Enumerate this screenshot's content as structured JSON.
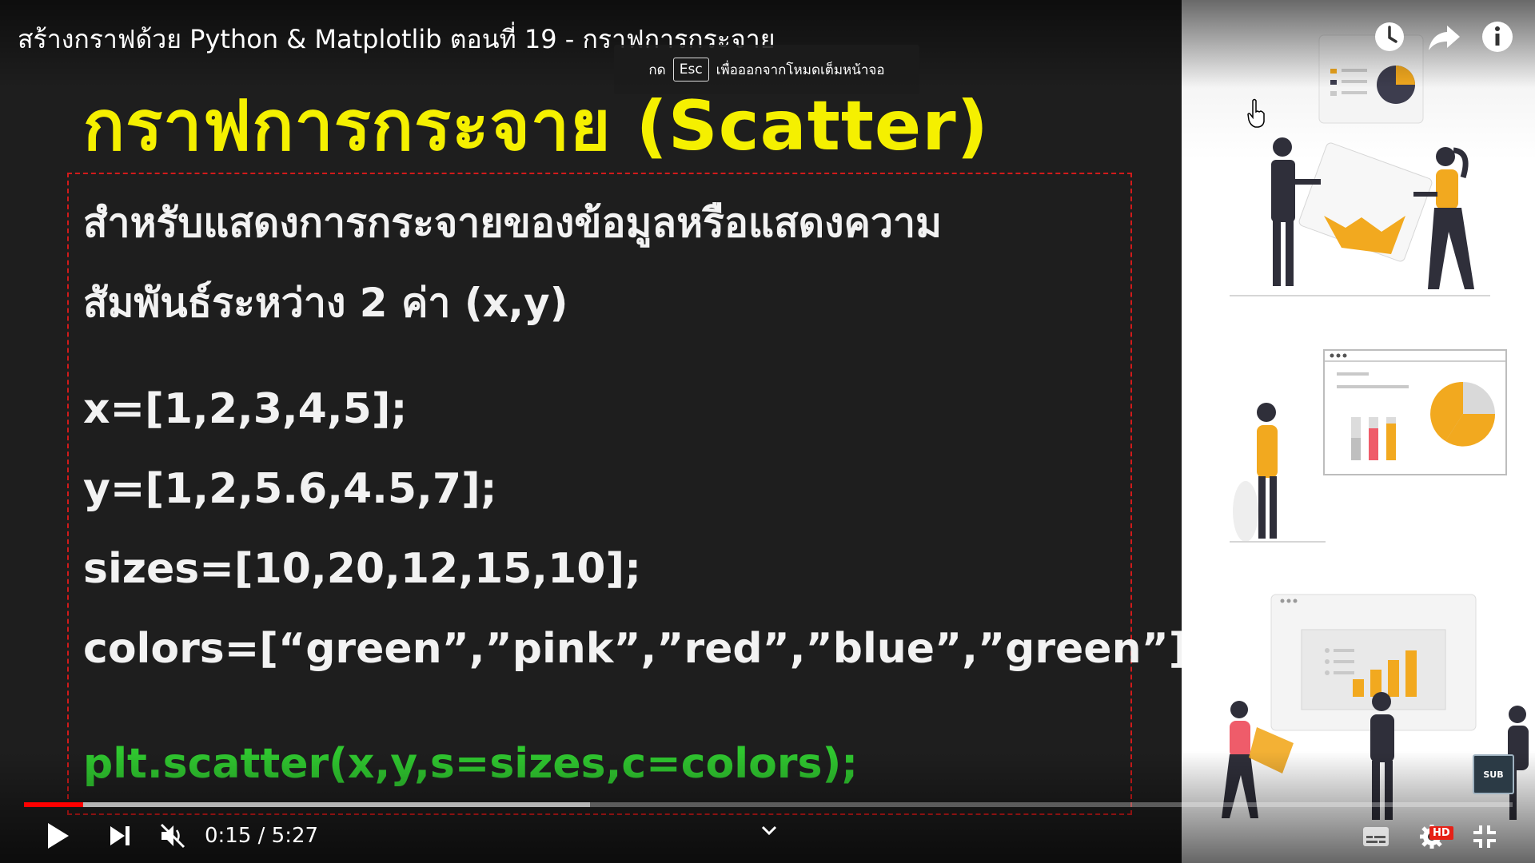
{
  "player": {
    "video_title": "สร้างกราฟด้วย Python & Matplotlib ตอนที่ 19 - กราฟการกระจาย",
    "esc_hint": {
      "prefix": "กด",
      "key": "Esc",
      "suffix": "เพื่อออกจากโหมดเต็มหน้าจอ"
    },
    "time_display": "0:15 / 5:27",
    "progress": {
      "played_fraction": 0.04,
      "buffered_fraction": 0.38
    },
    "hd_badge": "HD",
    "watermark_label": "SUB",
    "icons": {
      "top": [
        "clock-icon",
        "share-icon",
        "info-icon"
      ],
      "controls": [
        "play-icon",
        "next-icon",
        "mute-icon",
        "chevron-down-icon",
        "subtitles-icon",
        "gear-icon",
        "exit-fullscreen-icon"
      ]
    },
    "colors": {
      "progress": "#ff0000",
      "heading": "#f5f000",
      "code_call": "#2fc72f",
      "box_border": "#d11a1a"
    }
  },
  "slide": {
    "heading": "กราฟการกระจาย (Scatter)",
    "description_line1": "สำหรับแสดงการกระจายของข้อมูลหรือแสดงความ",
    "description_line2": "สัมพันธ์ระหว่าง 2 ค่า (x,y)",
    "code_x": "x=[1,2,3,4,5];",
    "code_y": "y=[1,2,5.6,4.5,7];",
    "code_sizes": "sizes=[10,20,12,15,10];",
    "code_colors": "colors=[“green”,”pink”,”red”,”blue”,”green”];",
    "code_scatter": "plt.scatter(x,y,s=sizes,c=colors);"
  }
}
